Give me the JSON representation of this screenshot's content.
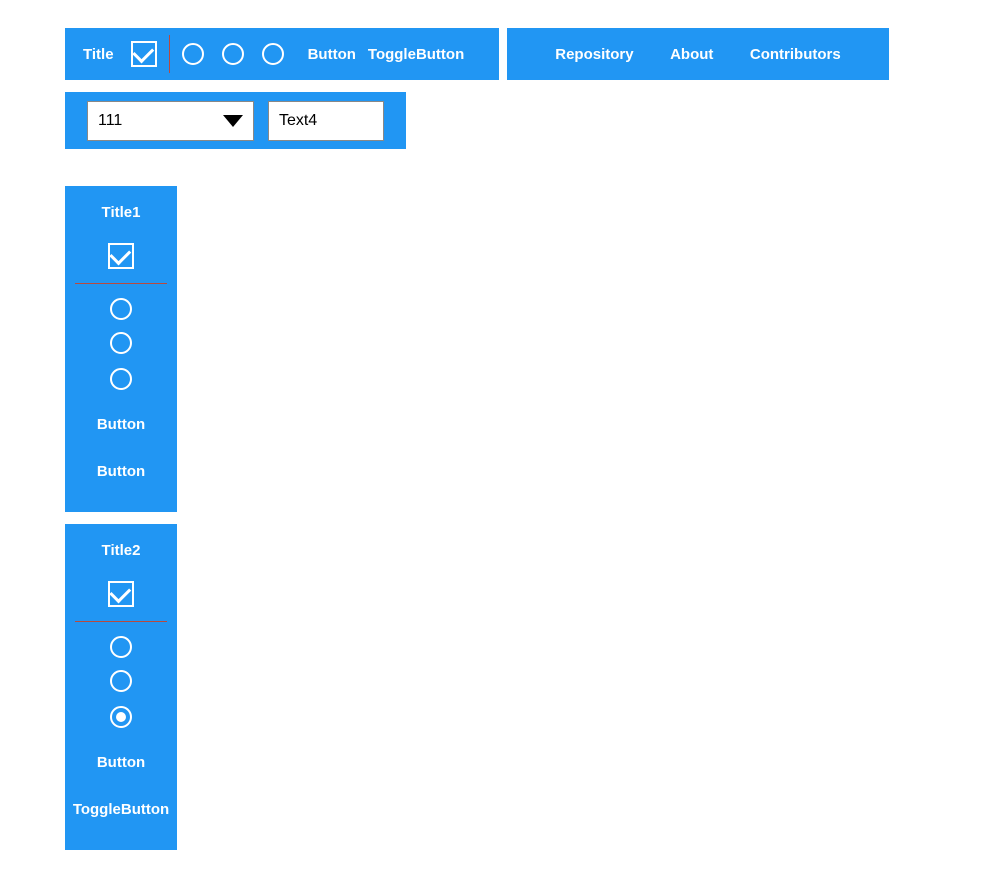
{
  "toolbar1": {
    "title": "Title",
    "button": "Button",
    "toggle": "ToggleButton"
  },
  "toolbar2": {
    "link1": "Repository",
    "link2": "About",
    "link3": "Contributors"
  },
  "toolbar3": {
    "combo_value": "111",
    "text_value": "Text4"
  },
  "panel1": {
    "title": "Title1",
    "button1": "Button",
    "button2": "Button"
  },
  "panel2": {
    "title": "Title2",
    "button1": "Button",
    "toggle": "ToggleButton"
  }
}
